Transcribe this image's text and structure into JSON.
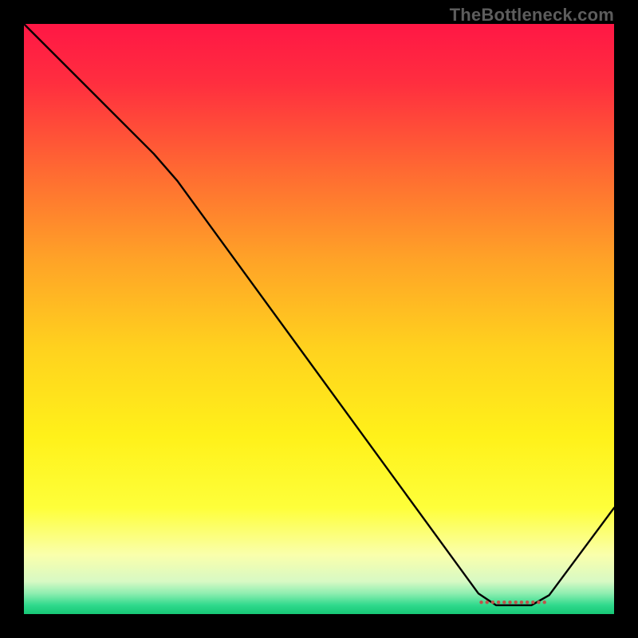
{
  "attribution": "TheBottleneck.com",
  "chart_data": {
    "type": "line",
    "title": "",
    "xlabel": "",
    "ylabel": "",
    "xlim": [
      0,
      100
    ],
    "ylim": [
      0,
      100
    ],
    "background_gradient": {
      "stops": [
        {
          "offset": 0.0,
          "color": "#ff1745"
        },
        {
          "offset": 0.1,
          "color": "#ff2e3f"
        },
        {
          "offset": 0.25,
          "color": "#ff6a32"
        },
        {
          "offset": 0.4,
          "color": "#ffa327"
        },
        {
          "offset": 0.55,
          "color": "#ffd21e"
        },
        {
          "offset": 0.7,
          "color": "#fff11a"
        },
        {
          "offset": 0.82,
          "color": "#feff3a"
        },
        {
          "offset": 0.9,
          "color": "#faffac"
        },
        {
          "offset": 0.945,
          "color": "#d7f9c4"
        },
        {
          "offset": 0.965,
          "color": "#8eeeb0"
        },
        {
          "offset": 0.985,
          "color": "#2fd98c"
        },
        {
          "offset": 1.0,
          "color": "#17c776"
        }
      ]
    },
    "series": [
      {
        "name": "bottleneck-curve",
        "color": "#000000",
        "width": 2.4,
        "points": [
          {
            "x": 0.0,
            "y": 100.0
          },
          {
            "x": 22.0,
            "y": 78.0
          },
          {
            "x": 26.0,
            "y": 73.4
          },
          {
            "x": 77.0,
            "y": 3.5
          },
          {
            "x": 80.0,
            "y": 1.5
          },
          {
            "x": 86.0,
            "y": 1.5
          },
          {
            "x": 89.0,
            "y": 3.2
          },
          {
            "x": 100.0,
            "y": 18.0
          }
        ]
      }
    ],
    "markers": [
      {
        "name": "optimal-range-marker",
        "color": "#c0524a",
        "y": 2.0,
        "x_start": 77.5,
        "x_end": 88.5,
        "dot_radius": 2.2,
        "dot_gap": 7.2
      }
    ]
  }
}
